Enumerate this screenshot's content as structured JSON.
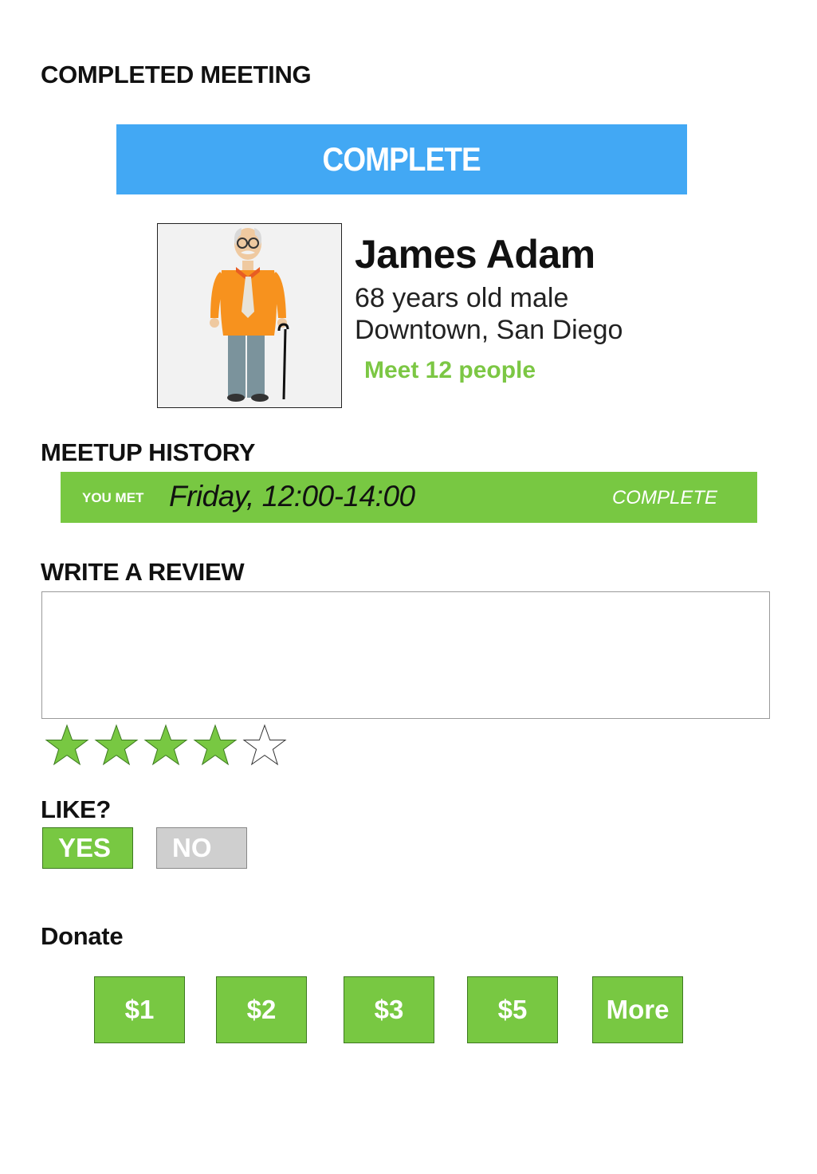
{
  "page": {
    "title": "COMPLETED MEETING"
  },
  "banner": {
    "label": "COMPLETE",
    "color": "#42a8f4"
  },
  "profile": {
    "name": "James Adam",
    "age_gender": "68 years old male",
    "location": "Downtown, San Diego",
    "meet_count": "Meet 12 people",
    "avatar_icon": "elderly-man-with-cane-icon"
  },
  "history": {
    "heading": "MEETUP HISTORY",
    "entries": [
      {
        "prefix": "YOU MET",
        "time": "Friday, 12:00-14:00",
        "status": "COMPLETE"
      }
    ]
  },
  "review": {
    "heading": "WRITE A REVIEW",
    "value": "",
    "placeholder": "",
    "rating": 4,
    "rating_max": 5
  },
  "like": {
    "heading": "LIKE?",
    "yes_label": "YES",
    "no_label": "NO",
    "selected": "YES"
  },
  "donate": {
    "heading": "Donate",
    "options": [
      "$1",
      "$2",
      "$3",
      "$5",
      "More"
    ]
  },
  "colors": {
    "accent_green": "#78c842",
    "text_green": "#7cc744",
    "banner_blue": "#42a8f4",
    "inactive_gray": "#cfcfcf"
  }
}
